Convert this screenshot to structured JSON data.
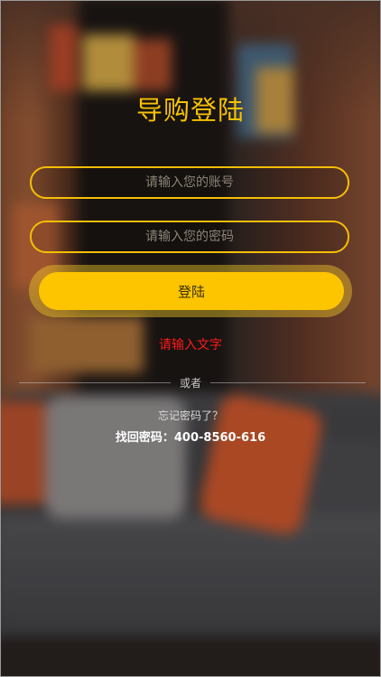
{
  "header": {
    "title": "导购登陆"
  },
  "form": {
    "account_placeholder": "请输入您的账号",
    "password_placeholder": "请输入您的密码",
    "login_label": "登陆"
  },
  "hint_text": "请输入文字",
  "divider_text": "或者",
  "recovery": {
    "question": "忘记密码了？",
    "phone_text": "找回密码：400-8560-616"
  },
  "colors": {
    "accent": "#fcc500",
    "title": "#f7c100",
    "hint": "#ff1a1a"
  }
}
